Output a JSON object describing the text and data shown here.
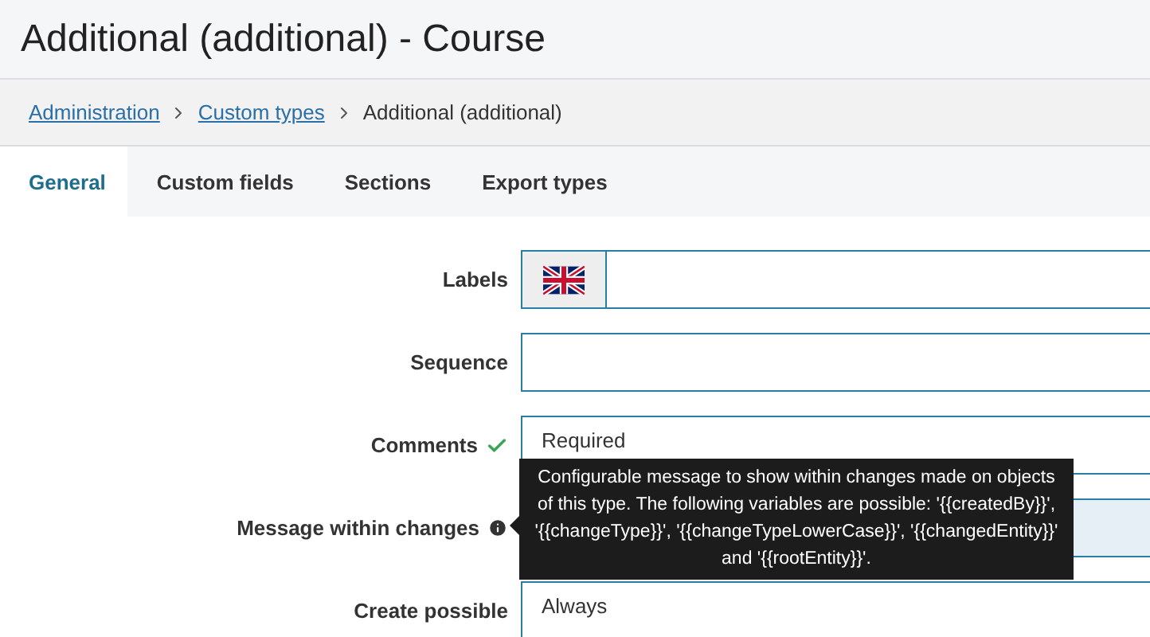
{
  "page_title": "Additional (additional) - Course",
  "breadcrumb": [
    {
      "label": "Administration",
      "kind": "link"
    },
    {
      "label": "Custom types",
      "kind": "link"
    },
    {
      "label": "Additional (additional)",
      "kind": "current"
    }
  ],
  "tabs": [
    {
      "label": "General",
      "selected": true
    },
    {
      "label": "Custom fields",
      "selected": false
    },
    {
      "label": "Sections",
      "selected": false
    },
    {
      "label": "Export types",
      "selected": false
    }
  ],
  "form": [
    {
      "label": "Labels",
      "kind": "language",
      "focused": false
    },
    {
      "label": "Sequence",
      "kind": "text",
      "focused": false
    },
    {
      "label": "Comments",
      "kind": "select",
      "validated": true,
      "value": "Required",
      "focused": false
    },
    {
      "label": "Message within changes",
      "kind": "text",
      "has_help": true,
      "focused": true
    },
    {
      "label": "Create possible",
      "kind": "select",
      "value": "Always",
      "focused": false
    }
  ],
  "tooltip": {
    "text": "Configurable message to show within changes made on objects of this type. The following variables are possible: '{{createdBy}}', '{{changeType}}', '{{changeTypeLowerCase}}', '{{changedEntity}}' and '{{rootEntity}}'."
  }
}
